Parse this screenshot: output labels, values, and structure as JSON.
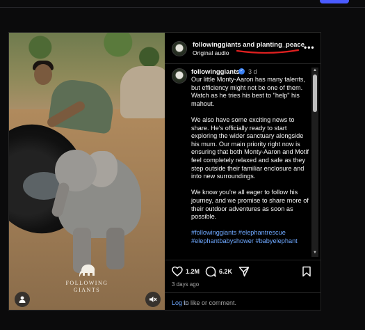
{
  "post": {
    "header": {
      "title": "followinggiants and planting_peace",
      "subtitle": "Original audio",
      "more_icon": "more-horizontal-icon"
    },
    "media": {
      "watermark_text": "FOLLOWING GIANTS",
      "user_icon": "user-tag-icon",
      "mute_icon": "muted-speaker-icon"
    },
    "caption": {
      "author": "followinggiants",
      "time": "3 d",
      "paragraphs": [
        "Our little Monty-Aaron has many talents, but efficiency might not be one of them. Watch as he tries his best to \"help\" his mahout.",
        "We also have some exciting news to share. He's officially ready to start exploring the wider sanctuary alongside his mum. Our main priority right now is ensuring that both Monty-Aaron and Motif feel completely relaxed and safe as they step outside their familiar enclosure and into new surroundings.",
        "We know you're all eager to follow his journey, and we promise to share more of their outdoor adventures as soon as possible."
      ],
      "hashtags_line1": "#followinggiants #elephantrescue",
      "hashtags_line2": "#elephantbabyshower #babyelephant"
    },
    "actions": {
      "likes": "1.2M",
      "comments": "6.2K",
      "date": "3 days ago",
      "login_link": "Log in",
      "login_suffix": "to like or comment."
    }
  },
  "colors": {
    "background": "#0b0b0c",
    "link": "#6ea8ff",
    "verified": "#3b82f6",
    "annotation": "#e02020",
    "accent_pill": "#4a5bff"
  }
}
